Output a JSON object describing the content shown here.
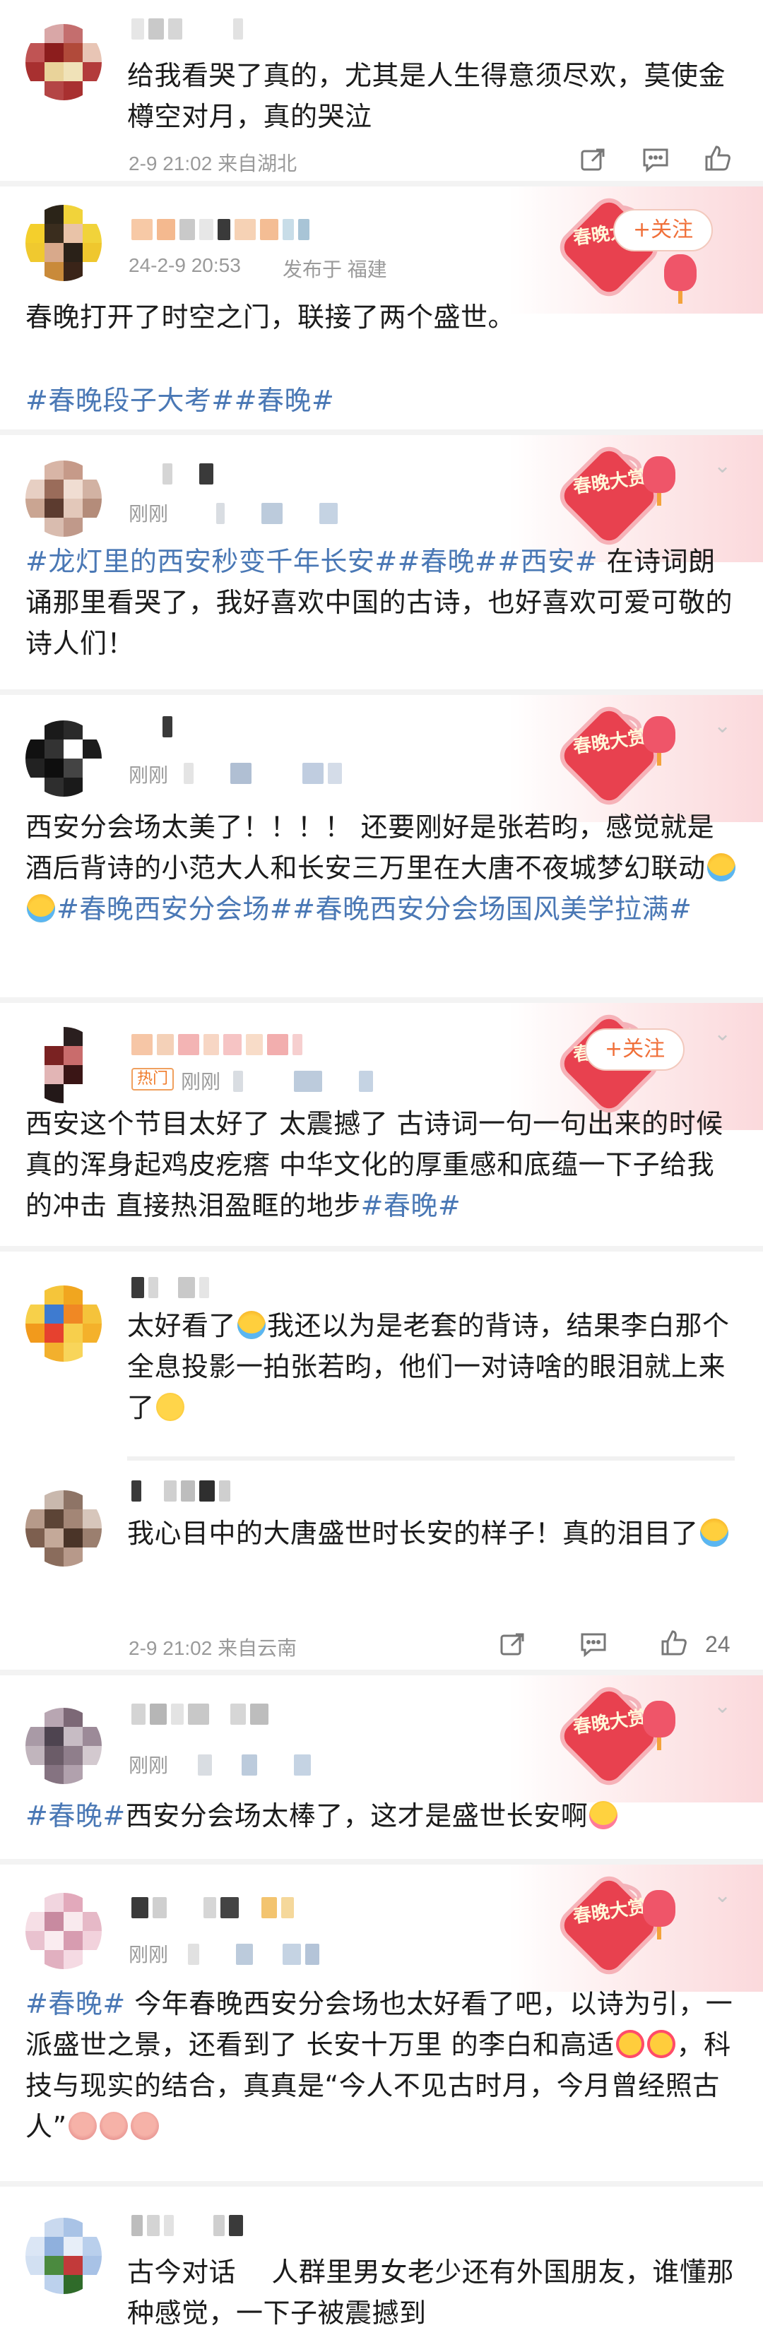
{
  "posts": [
    {
      "name_hidden": true,
      "text": "给我看哭了真的，尤其是人生得意须尽欢，莫使金樽空对月，真的哭泣",
      "meta": "2-9 21:02  来自湖北",
      "actions": {
        "share_icon": "share-icon",
        "comment_icon": "comment-icon",
        "like_icon": "like-icon"
      }
    },
    {
      "meta_date": "24-2-9 20:53",
      "meta_location": "发布于 福建",
      "follow_label": "+关注",
      "festival_badge": "春晚大赏",
      "text_plain": "春晚打开了时空之门，联接了两个盛世。",
      "tags": "#春晚段子大考##春晚#"
    },
    {
      "meta_time": "刚刚",
      "festival_badge": "春晚大赏",
      "tags": "#龙灯里的西安秒变千年长安##春晚##西安#",
      "text": " 在诗词朗诵那里看哭了，我好喜欢中国的古诗，也好喜欢可爱可敬的诗人们！"
    },
    {
      "meta_time": "刚刚",
      "festival_badge": "春晚大赏",
      "text": "西安分会场太美了！！！！ 还要刚好是张若昀，感觉就是酒后背诗的小范大人和长安三万里在大唐不夜城梦幻联动",
      "tags": "#春晚西安分会场##春晚西安分会场国风美学拉满#"
    },
    {
      "hot_label": "热门",
      "meta_time": "刚刚",
      "follow_label": "+关注",
      "festival_badge": "春晚大赏",
      "text": "西安这个节目太好了 太震撼了 古诗词一句一句出来的时候真的浑身起鸡皮疙瘩 中华文化的厚重感和底蕴一下子给我的冲击 直接热泪盈眶的地步",
      "tags": "#春晚#"
    },
    {
      "text_a": "太好看了",
      "text_b": "我还以为是老套的背诗，结果李白那个全息投影一拍张若昀，他们一对诗啥的眼泪就上来了"
    },
    {
      "text": "我心目中的大唐盛世时长安的样子！真的泪目了",
      "meta": "2-9  21:02  来自云南",
      "like_count": "24"
    },
    {
      "meta_time": "刚刚",
      "festival_badge": "春晚大赏",
      "tags": "#春晚#",
      "text": "西安分会场太棒了，这才是盛世长安啊"
    },
    {
      "meta_time": "刚刚",
      "festival_badge": "春晚大赏",
      "tags": "#春晚#",
      "text_a": " 今年春晚西安分会场也太好看了吧，以诗为引，一派盛世之景，还看到了 长安十万里 的李白和高适",
      "text_b": "，科技与现实的结合，真真是“今人不见古时月，今月曾经照古人”"
    },
    {
      "text": "古今对话    人群里男女老少还有外国朋友，谁懂那种感觉，一下子被震撼到"
    }
  ],
  "colors": {
    "tag": "#4a78b5",
    "meta": "#9a9a9a",
    "follow": "#f0703a",
    "badge": "#e8414f"
  }
}
